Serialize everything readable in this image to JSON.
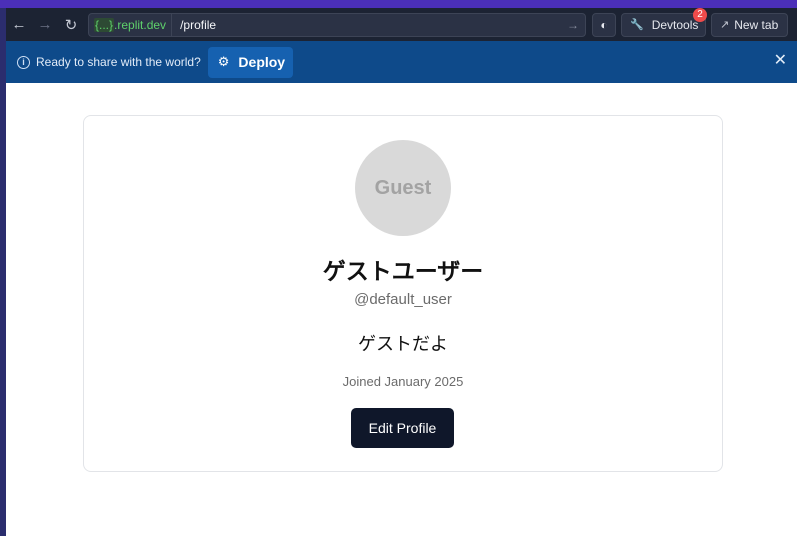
{
  "toolbar": {
    "back_icon": "arrow-left-icon",
    "forward_icon": "arrow-right-icon",
    "reload_icon": "reload-icon",
    "url": {
      "domain_prefix": "{...}",
      "domain_suffix": ".replit.dev",
      "path": "/profile"
    },
    "devtools_label": "Devtools",
    "devtools_badge": "2",
    "newtab_label": "New tab"
  },
  "deploy_banner": {
    "message": "Ready to share with the world?",
    "deploy_label": "Deploy"
  },
  "profile": {
    "avatar_text": "Guest",
    "display_name": "ゲストユーザー",
    "username": "@default_user",
    "bio": "ゲストだよ",
    "joined": "Joined January 2025",
    "edit_label": "Edit Profile"
  },
  "colors": {
    "toolbar_bg": "#1c2333",
    "banner_bg": "#0e4a8a",
    "primary_button": "#0f172a",
    "url_domain": "#5ed06b"
  }
}
